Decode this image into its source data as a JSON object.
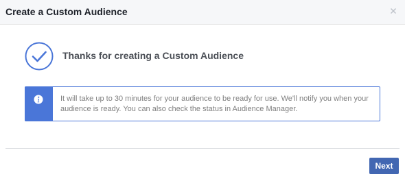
{
  "dialog": {
    "title": "Create a Custom Audience",
    "close_icon": "close-icon"
  },
  "success": {
    "icon": "checkmark-circle-icon",
    "message": "Thanks for creating a Custom Audience"
  },
  "info": {
    "icon": "info-icon",
    "text": "It will take up to 30 minutes for your audience to be ready for use. We'll notify you when your audience is ready. You can also check the status in Audience Manager."
  },
  "footer": {
    "next_label": "Next"
  },
  "colors": {
    "accent": "#4a76d8",
    "button": "#4267b2",
    "header_bg": "#f6f7f9"
  }
}
